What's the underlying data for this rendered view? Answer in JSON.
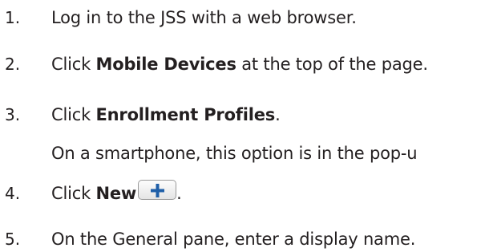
{
  "steps": [
    {
      "number": "1.",
      "text": "Log in to the JSS with a web browser."
    },
    {
      "number": "2.",
      "prefix": "Click ",
      "bold": "Mobile Devices",
      "suffix": " at the top of the page."
    },
    {
      "number": "3.",
      "prefix": "Click ",
      "bold": "Enrollment Profiles",
      "suffix": ".",
      "note": "On a smartphone, this option is in the pop-u"
    },
    {
      "number": "4.",
      "prefix": "Click ",
      "bold": "New",
      "icon": "plus-icon",
      "suffix": "."
    },
    {
      "number": "5.",
      "text": "On the General pane, enter a display name."
    }
  ],
  "colors": {
    "text": "#231f20",
    "plus_icon": "#1f5fa8",
    "button_border": "#9a9a9a"
  }
}
